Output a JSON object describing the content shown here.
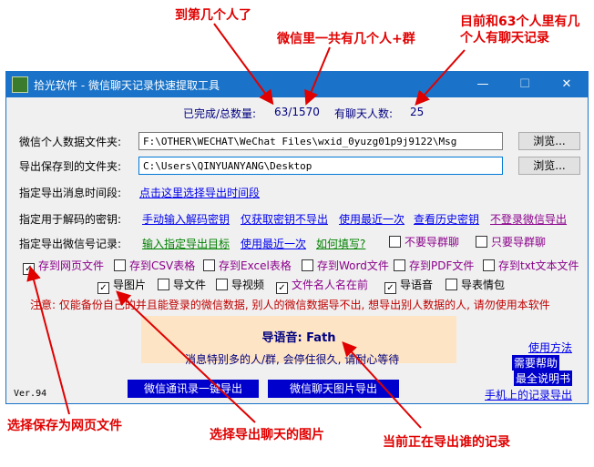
{
  "annotations": {
    "top_1": "到第几个人了",
    "top_2": "微信里一共有几个人+群",
    "top_3": "目前和63个人里有几个人有聊天记录",
    "bottom_1": "选择保存为网页文件",
    "bottom_2": "选择导出聊天的图片",
    "bottom_3": "当前正在导出谁的记录"
  },
  "window": {
    "title": "拾光软件 - 微信聊天记录快速提取工具",
    "minimize": "—",
    "maximize": "☐",
    "close": "✕"
  },
  "status": {
    "done_label": "已完成/总数量:",
    "done_value": "63/1570",
    "chat_label": "有聊天人数:",
    "chat_value": "25"
  },
  "fields": {
    "data_dir_label": "微信个人数据文件夹:",
    "data_dir_value": "F:\\OTHER\\WECHAT\\WeChat Files\\wxid_0yuzg01p9j9122\\Msg",
    "save_dir_label": "导出保存到的文件夹:",
    "save_dir_value": "C:\\Users\\QINYUANYANG\\Desktop",
    "browse_label": "浏览..."
  },
  "time_row": {
    "label": "指定导出消息时间段:",
    "link": "点击这里选择导出时间段"
  },
  "key_row": {
    "label": "指定用于解码的密钥:",
    "links": [
      "手动输入解码密钥",
      "仅获取密钥不导出",
      "使用最近一次",
      "查看历史密钥",
      "不登录微信导出"
    ]
  },
  "account_row": {
    "label": "指定导出微信号记录:",
    "links": [
      "输入指定导出目标",
      "使用最近一次",
      "如何填写?"
    ],
    "options": [
      {
        "label": "不要导群聊",
        "checked": false
      },
      {
        "label": "只要导群聊",
        "checked": false
      }
    ]
  },
  "formats": [
    {
      "label": "存到网页文件",
      "checked": true
    },
    {
      "label": "存到CSV表格",
      "checked": false
    },
    {
      "label": "存到Excel表格",
      "checked": false
    },
    {
      "label": "存到Word文件",
      "checked": false
    },
    {
      "label": "存到PDF文件",
      "checked": false
    },
    {
      "label": "存到txt文本文件",
      "checked": false
    }
  ],
  "media": [
    {
      "label": "导图片",
      "checked": true
    },
    {
      "label": "导文件",
      "checked": false
    },
    {
      "label": "导视频",
      "checked": false
    },
    {
      "label": "文件名人名在前",
      "checked": true
    },
    {
      "label": "导语音",
      "checked": true
    },
    {
      "label": "导表情包",
      "checked": false
    }
  ],
  "notice": "注意: 仅能备份自己的并且能登录的微信数据, 别人的微信数据导不出, 想导出别人数据的人, 请勿使用本软件",
  "progress": {
    "now": "导语音: Fath",
    "hint": "消息特别多的人/群, 会停住很久, 请耐心等待"
  },
  "footer": {
    "version": "Ver.94",
    "export_contacts": "微信通讯录一键导出",
    "export_images": "微信聊天图片导出",
    "help": "使用方法",
    "need_help": "需要帮助",
    "latest_guide": "最全说明书",
    "mobile_export": "手机上的记录导出"
  },
  "colors": {
    "titlebar": "#1a73c8",
    "annotation": "#e00000",
    "link_blue": "#0000ee",
    "link_green": "#008000",
    "link_purple": "#8b008b",
    "panel": "#fde4c4"
  }
}
